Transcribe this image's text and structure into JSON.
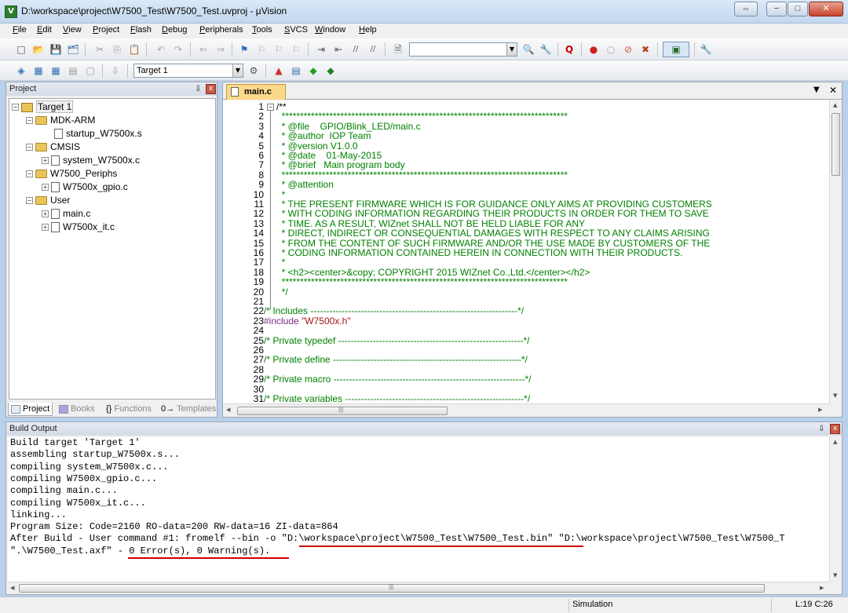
{
  "window": {
    "title": "D:\\workspace\\project\\W7500_Test\\W7500_Test.uvproj - µVision",
    "icon_label": "V",
    "restore_label": "⇔",
    "minimize_label": "−",
    "maximize_label": "□",
    "close_label": "✕"
  },
  "menu": [
    {
      "label": "File",
      "u": "F",
      "rest": "ile"
    },
    {
      "label": "Edit",
      "u": "E",
      "rest": "dit"
    },
    {
      "label": "View",
      "u": "V",
      "rest": "iew"
    },
    {
      "label": "Project",
      "u": "P",
      "rest": "roject"
    },
    {
      "label": "Flash",
      "u": "F",
      "rest": "lash"
    },
    {
      "label": "Debug",
      "u": "D",
      "rest": "ebug"
    },
    {
      "label": "Peripherals",
      "u": "P",
      "rest": "eripherals"
    },
    {
      "label": "Tools",
      "u": "T",
      "rest": "ools"
    },
    {
      "label": "SVCS",
      "u": "S",
      "rest": "VCS"
    },
    {
      "label": "Window",
      "u": "W",
      "rest": "indow"
    },
    {
      "label": "Help",
      "u": "H",
      "rest": "elp"
    }
  ],
  "toolbar": {
    "find_value": "",
    "target_select": "Target 1",
    "dropdown_glyph": "▼",
    "icons": {
      "new": "□",
      "open": "📂",
      "save": "💾",
      "save_all": "🗂",
      "cut": "✂",
      "copy": "⎘",
      "paste": "📋",
      "undo": "↶",
      "redo": "↷",
      "nav_back": "⇐",
      "nav_fwd": "⇒",
      "bookmark": "⚑",
      "bm_prev": "⚐",
      "bm_next": "⚐",
      "bm_clear": "⚐",
      "indent": "⇥",
      "unindent": "⇤",
      "comment": "//",
      "uncomment": "//",
      "find_in_files": "🗎",
      "find": "🔍",
      "debug": "Q",
      "breakpoint": "●",
      "bp_disable": "○",
      "bp_kill": "⊘",
      "bp_all": "✖",
      "window_layout": "▣",
      "config": "🔧",
      "translate": "◈",
      "build": "▦",
      "rebuild": "▦",
      "batch": "▤",
      "stop": "▢",
      "load": "⇩",
      "target_options": "⚙",
      "manage_env": "▲",
      "manage_books": "▤",
      "select_packs": "◆",
      "pack_installer": "◆"
    }
  },
  "project_panel": {
    "title": "Project",
    "pin": "⇩",
    "close": "x",
    "tree": [
      {
        "label": "Target 1",
        "level": 0,
        "type": "target",
        "expander": "−"
      },
      {
        "label": "MDK-ARM",
        "level": 1,
        "type": "folder",
        "expander": "−"
      },
      {
        "label": "startup_W7500x.s",
        "level": 2,
        "type": "file",
        "expander": ""
      },
      {
        "label": "CMSIS",
        "level": 1,
        "type": "folder",
        "expander": "−"
      },
      {
        "label": "system_W7500x.c",
        "level": 2,
        "type": "file",
        "expander": "+"
      },
      {
        "label": "W7500_Periphs",
        "level": 1,
        "type": "folder",
        "expander": "−"
      },
      {
        "label": "W7500x_gpio.c",
        "level": 2,
        "type": "file",
        "expander": "+"
      },
      {
        "label": "User",
        "level": 1,
        "type": "folder",
        "expander": "−"
      },
      {
        "label": "main.c",
        "level": 2,
        "type": "file",
        "expander": "+"
      },
      {
        "label": "W7500x_it.c",
        "level": 2,
        "type": "file",
        "expander": "+"
      }
    ],
    "tabs": [
      {
        "label": "Project",
        "active": true
      },
      {
        "label": "Books",
        "active": false
      },
      {
        "label": "Functions",
        "active": false,
        "prefix": "{}"
      },
      {
        "label": "Templates",
        "active": false,
        "prefix": "0→"
      }
    ]
  },
  "editor": {
    "tab_label": "main.c",
    "dropdown": "▼",
    "close": "✕",
    "lines": [
      {
        "n": "1",
        "text": "/**",
        "cls": ""
      },
      {
        "n": "2",
        "text": "  ******************************************************************************",
        "cls": ""
      },
      {
        "n": "3",
        "text": "  * @file    GPIO/Blink_LED/main.c",
        "cls": ""
      },
      {
        "n": "4",
        "text": "  * @author  IOP Team",
        "cls": ""
      },
      {
        "n": "5",
        "text": "  * @version V1.0.0",
        "cls": ""
      },
      {
        "n": "6",
        "text": "  * @date    01-May-2015",
        "cls": ""
      },
      {
        "n": "7",
        "text": "  * @brief   Main program body",
        "cls": ""
      },
      {
        "n": "8",
        "text": "  ******************************************************************************",
        "cls": ""
      },
      {
        "n": "9",
        "text": "  * @attention",
        "cls": ""
      },
      {
        "n": "10",
        "text": "  *",
        "cls": ""
      },
      {
        "n": "11",
        "text": "  * THE PRESENT FIRMWARE WHICH IS FOR GUIDANCE ONLY AIMS AT PROVIDING CUSTOMERS",
        "cls": ""
      },
      {
        "n": "12",
        "text": "  * WITH CODING INFORMATION REGARDING THEIR PRODUCTS IN ORDER FOR THEM TO SAVE",
        "cls": ""
      },
      {
        "n": "13",
        "text": "  * TIME. AS A RESULT, WIZnet SHALL NOT BE HELD LIABLE FOR ANY",
        "cls": ""
      },
      {
        "n": "14",
        "text": "  * DIRECT, INDIRECT OR CONSEQUENTIAL DAMAGES WITH RESPECT TO ANY CLAIMS ARISING",
        "cls": ""
      },
      {
        "n": "15",
        "text": "  * FROM THE CONTENT OF SUCH FIRMWARE AND/OR THE USE MADE BY CUSTOMERS OF THE",
        "cls": ""
      },
      {
        "n": "16",
        "text": "  * CODING INFORMATION CONTAINED HEREIN IN CONNECTION WITH THEIR PRODUCTS.",
        "cls": ""
      },
      {
        "n": "17",
        "text": "  *",
        "cls": ""
      },
      {
        "n": "18",
        "text": "  * <h2><center>&copy; COPYRIGHT 2015 WIZnet Co.,Ltd.</center></h2>",
        "cls": ""
      },
      {
        "n": "19",
        "text": "  ******************************************************************************",
        "cls": ""
      },
      {
        "n": "20",
        "text": "  */",
        "cls": ""
      },
      {
        "n": "21",
        "text": "",
        "cls": ""
      },
      {
        "n": "22",
        "text": "/* Includes ------------------------------------------------------------------*/",
        "cls": ""
      },
      {
        "n": "23",
        "text": "#include ",
        "cls": "pp",
        "str": "\"W7500x.h\""
      },
      {
        "n": "24",
        "text": "",
        "cls": ""
      },
      {
        "n": "25",
        "text": "/* Private typedef -----------------------------------------------------------*/",
        "cls": ""
      },
      {
        "n": "26",
        "text": "",
        "cls": ""
      },
      {
        "n": "27",
        "text": "/* Private define ------------------------------------------------------------*/",
        "cls": ""
      },
      {
        "n": "28",
        "text": "",
        "cls": ""
      },
      {
        "n": "29",
        "text": "/* Private macro -------------------------------------------------------------*/",
        "cls": ""
      },
      {
        "n": "30",
        "text": "",
        "cls": ""
      },
      {
        "n": "31",
        "text": "/* Private variables ---------------------------------------------------------*/",
        "cls": ""
      }
    ],
    "fold_minus": "−",
    "scroll_up": "▲",
    "scroll_down": "▼",
    "scroll_left": "◀",
    "scroll_right": "▶",
    "grip": "|||"
  },
  "build_output": {
    "title": "Build Output",
    "pin": "⇩",
    "close": "x",
    "lines": [
      "Build target 'Target 1'",
      "assembling startup_W7500x.s...",
      "compiling system_W7500x.c...",
      "compiling W7500x_gpio.c...",
      "compiling main.c...",
      "compiling W7500x_it.c...",
      "linking...",
      "Program Size: Code=2160 RO-data=200 RW-data=16 ZI-data=864",
      "After Build - User command #1: fromelf --bin -o \"D:\\workspace\\project\\W7500_Test\\W7500_Test.bin\" \"D:\\workspace\\project\\W7500_Test\\W7500_T",
      "\".\\W7500_Test.axf\" - 0 Error(s), 0 Warning(s)."
    ],
    "highlight_color": "#d00000"
  },
  "status": {
    "mode": "Simulation",
    "position": "L:19 C:26"
  }
}
